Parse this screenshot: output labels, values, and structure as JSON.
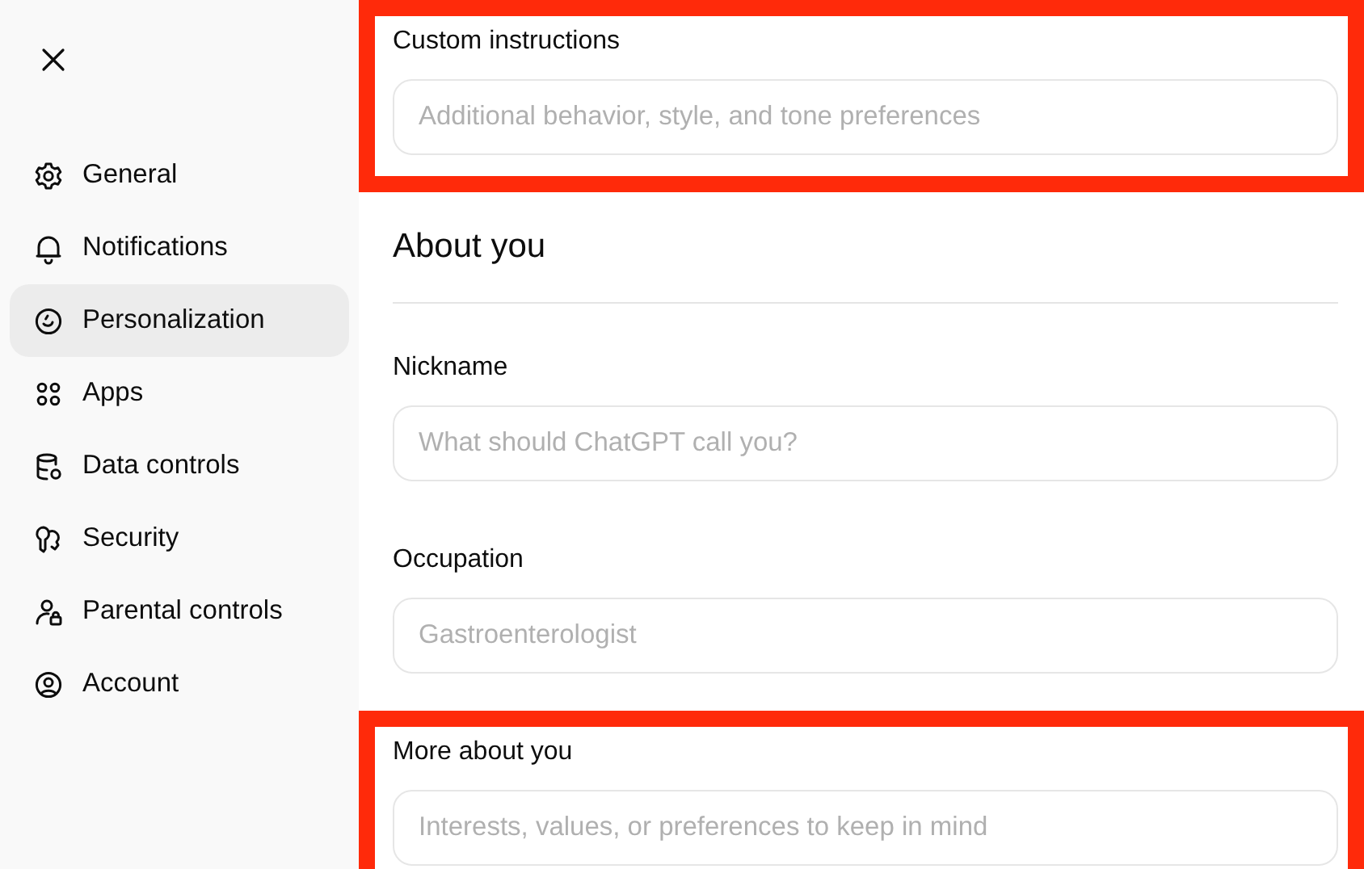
{
  "sidebar": {
    "items": [
      {
        "label": "General",
        "selected": false
      },
      {
        "label": "Notifications",
        "selected": false
      },
      {
        "label": "Personalization",
        "selected": true
      },
      {
        "label": "Apps",
        "selected": false
      },
      {
        "label": "Data controls",
        "selected": false
      },
      {
        "label": "Security",
        "selected": false
      },
      {
        "label": "Parental controls",
        "selected": false
      },
      {
        "label": "Account",
        "selected": false
      }
    ]
  },
  "sections": [
    {
      "kind": "field",
      "label": "Custom instructions",
      "placeholder": "Additional behavior, style, and tone preferences",
      "highlighted": true
    },
    {
      "kind": "heading",
      "title": "About you",
      "highlighted": false
    },
    {
      "kind": "field",
      "label": "Nickname",
      "placeholder": "What should ChatGPT call you?",
      "highlighted": false
    },
    {
      "kind": "field",
      "label": "Occupation",
      "placeholder": "Gastroenterologist",
      "highlighted": false
    },
    {
      "kind": "field",
      "label": "More about you",
      "placeholder": "Interests, values, or preferences to keep in mind",
      "highlighted": true
    }
  ]
}
